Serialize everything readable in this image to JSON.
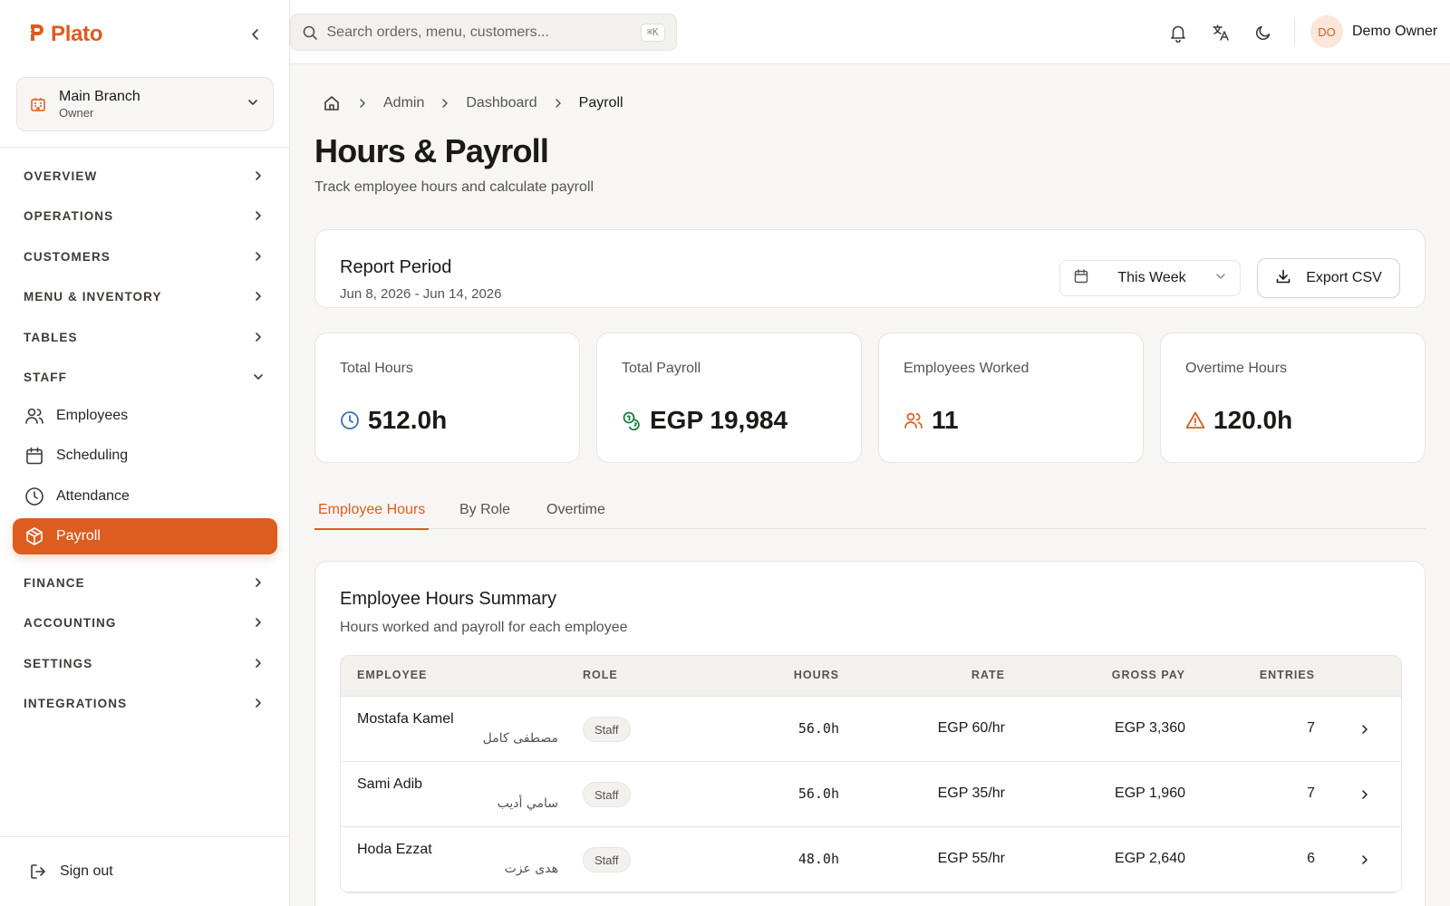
{
  "app": {
    "name": "Plato"
  },
  "branch": {
    "name": "Main Branch",
    "role": "Owner"
  },
  "sidebar": {
    "sections": [
      {
        "label": "OVERVIEW",
        "expanded": false
      },
      {
        "label": "OPERATIONS",
        "expanded": false
      },
      {
        "label": "CUSTOMERS",
        "expanded": false
      },
      {
        "label": "MENU & INVENTORY",
        "expanded": false
      },
      {
        "label": "TABLES",
        "expanded": false
      },
      {
        "label": "STAFF",
        "expanded": true
      },
      {
        "label": "FINANCE",
        "expanded": false
      },
      {
        "label": "ACCOUNTING",
        "expanded": false
      },
      {
        "label": "SETTINGS",
        "expanded": false
      },
      {
        "label": "INTEGRATIONS",
        "expanded": false
      }
    ],
    "staff_items": [
      {
        "label": "Employees",
        "icon": "users-icon",
        "active": false
      },
      {
        "label": "Scheduling",
        "icon": "calendar-icon",
        "active": false
      },
      {
        "label": "Attendance",
        "icon": "clock-icon",
        "active": false
      },
      {
        "label": "Payroll",
        "icon": "box-icon",
        "active": true
      }
    ],
    "signout_label": "Sign out"
  },
  "topbar": {
    "search_placeholder": "Search orders, menu, customers...",
    "search_shortcut": "⌘K",
    "user_initials": "DO",
    "user_name": "Demo Owner"
  },
  "breadcrumb": [
    "Admin",
    "Dashboard",
    "Payroll"
  ],
  "page": {
    "title": "Hours & Payroll",
    "subtitle": "Track employee hours and calculate payroll"
  },
  "report": {
    "title": "Report Period",
    "range": "Jun 8, 2026 - Jun 14, 2026",
    "period_selected": "This Week",
    "export_label": "Export CSV"
  },
  "stats": [
    {
      "label": "Total Hours",
      "value": "512.0h",
      "icon": "clock-icon",
      "color": "#3b6fb6"
    },
    {
      "label": "Total Payroll",
      "value": "EGP 19,984",
      "icon": "coins-icon",
      "color": "#15803d"
    },
    {
      "label": "Employees Worked",
      "value": "11",
      "icon": "users-icon",
      "color": "#dd5c1f"
    },
    {
      "label": "Overtime Hours",
      "value": "120.0h",
      "icon": "alert-triangle-icon",
      "color": "#dd5c1f"
    }
  ],
  "tabs": [
    {
      "label": "Employee Hours",
      "active": true
    },
    {
      "label": "By Role",
      "active": false
    },
    {
      "label": "Overtime",
      "active": false
    }
  ],
  "summary": {
    "title": "Employee Hours Summary",
    "subtitle": "Hours worked and payroll for each employee",
    "columns": [
      "EMPLOYEE",
      "ROLE",
      "HOURS",
      "RATE",
      "GROSS PAY",
      "ENTRIES"
    ],
    "rows": [
      {
        "name": "Mostafa Kamel",
        "name_ar": "مصطفى كامل",
        "role": "Staff",
        "hours": "56.0h",
        "rate": "EGP 60/hr",
        "gross": "EGP 3,360",
        "entries": "7"
      },
      {
        "name": "Sami Adib",
        "name_ar": "سامي أديب",
        "role": "Staff",
        "hours": "56.0h",
        "rate": "EGP 35/hr",
        "gross": "EGP 1,960",
        "entries": "7"
      },
      {
        "name": "Hoda Ezzat",
        "name_ar": "هدى عزت",
        "role": "Staff",
        "hours": "48.0h",
        "rate": "EGP 55/hr",
        "gross": "EGP 2,640",
        "entries": "6"
      }
    ]
  },
  "colors": {
    "accent": "#dd5c1f",
    "background": "#f7f6f4",
    "border": "#e7e5e4"
  }
}
